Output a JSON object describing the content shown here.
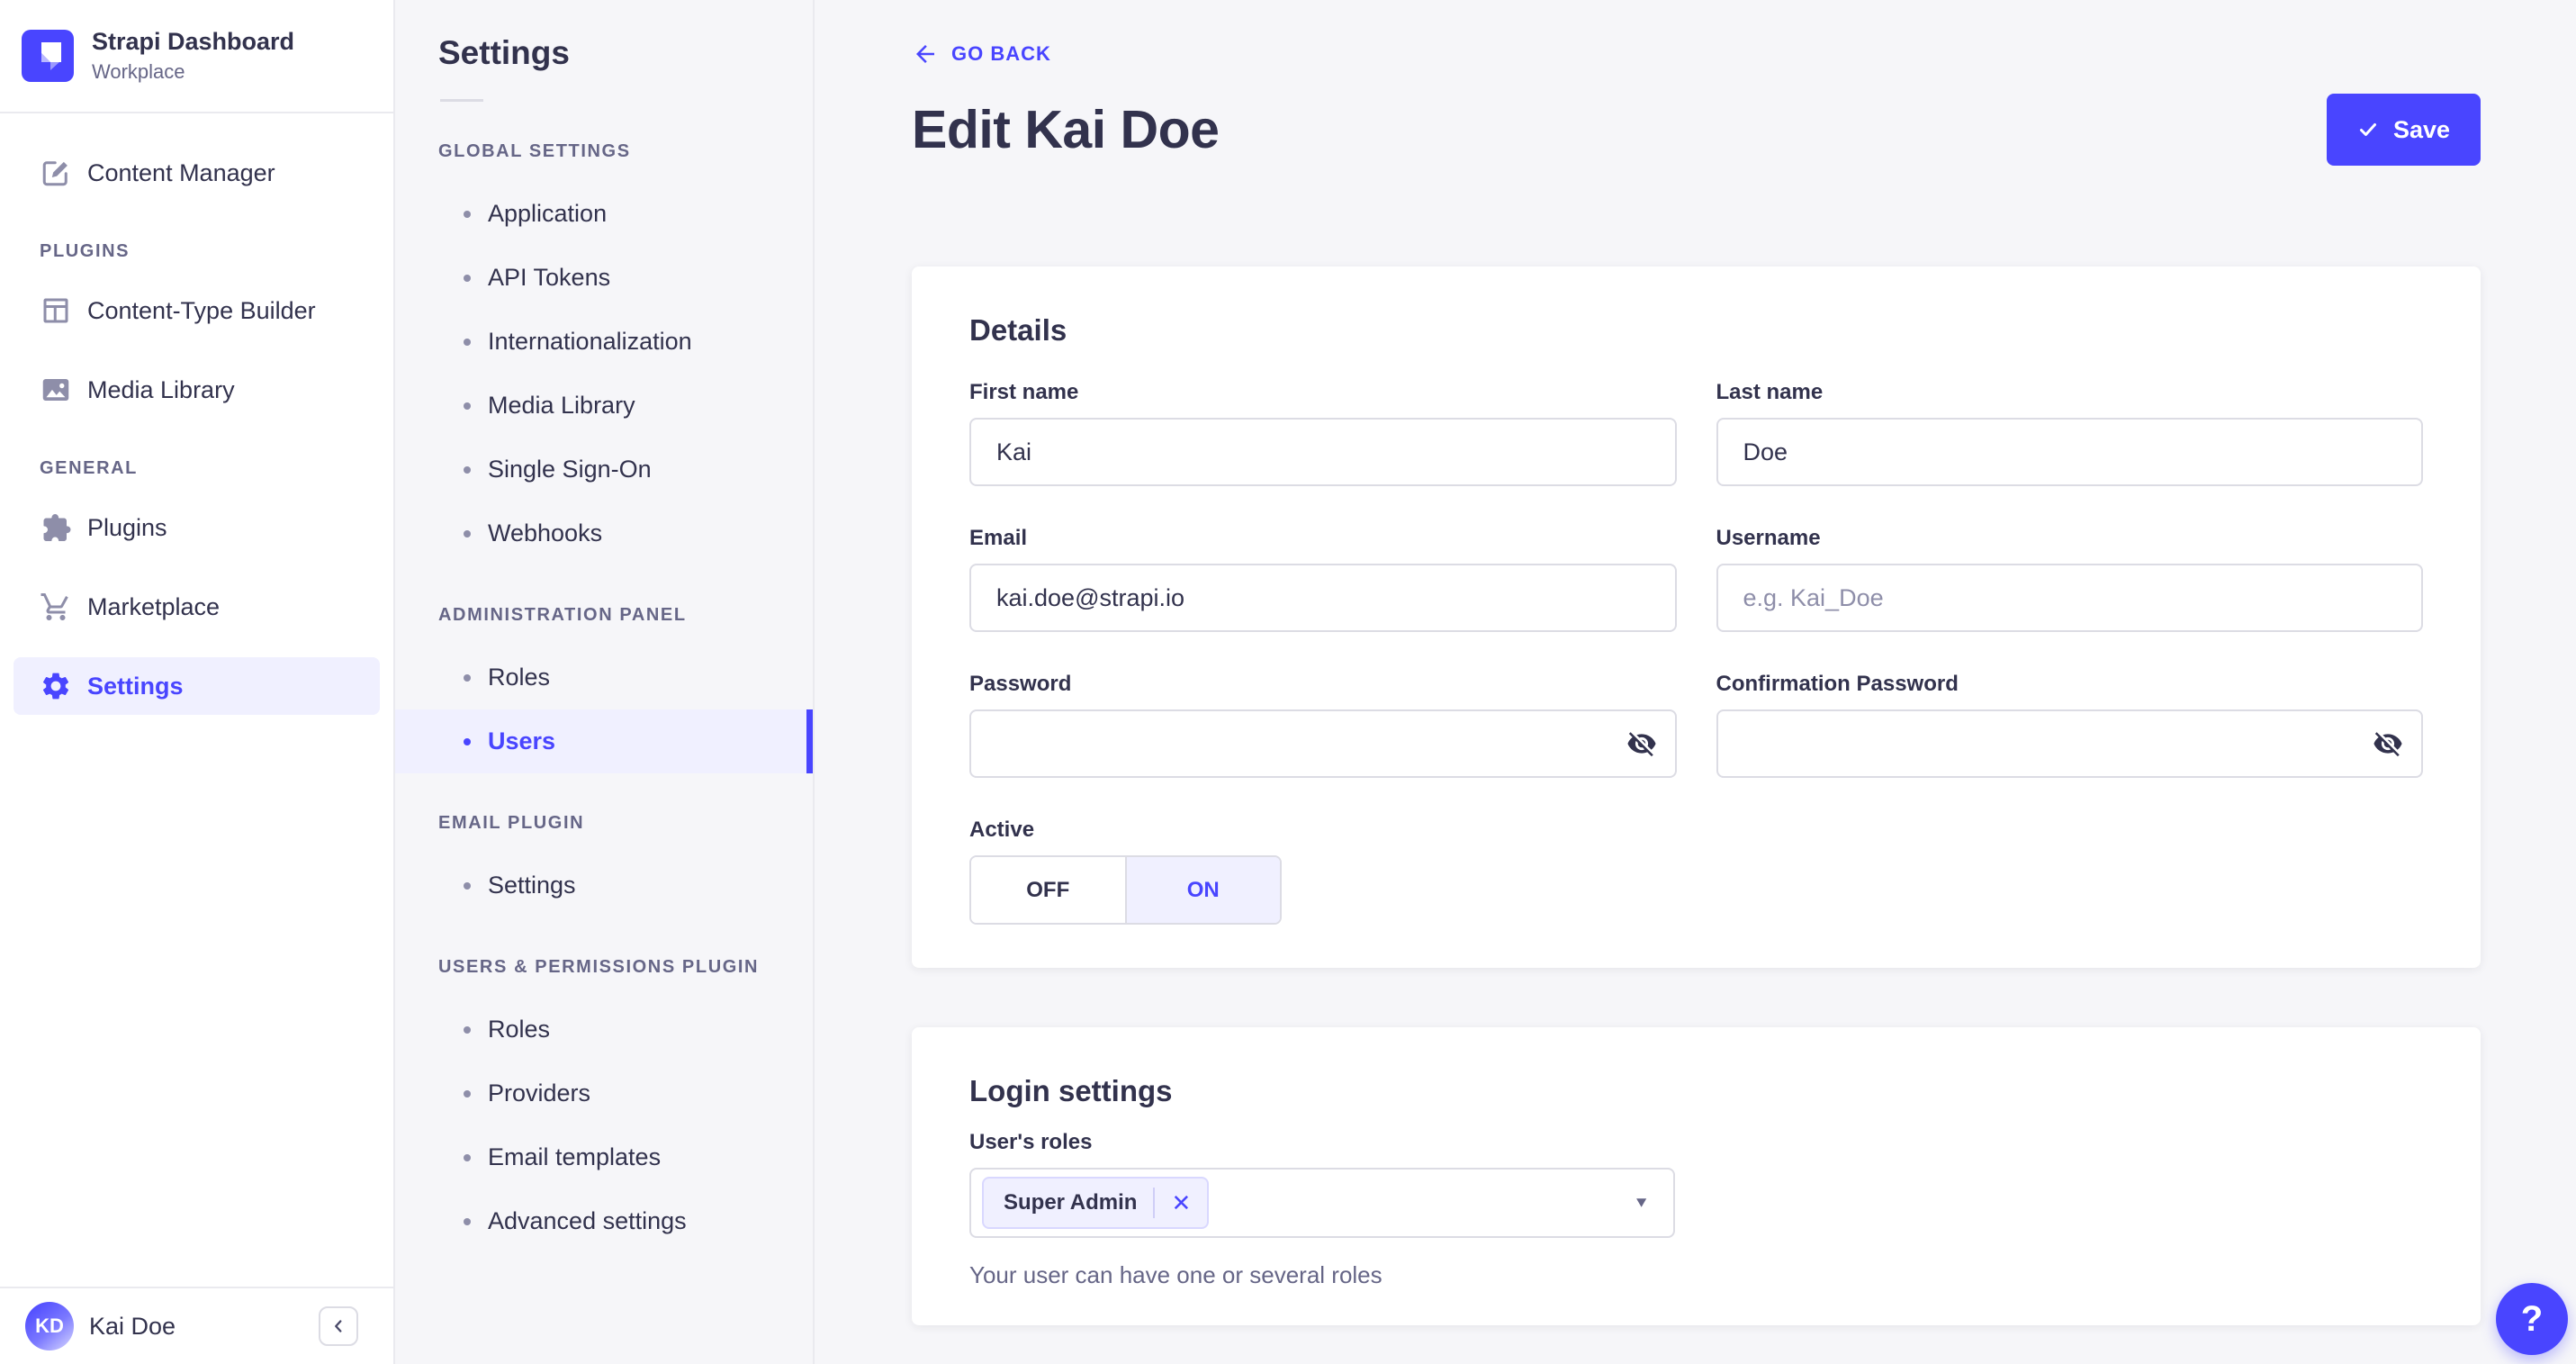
{
  "brand": {
    "title": "Strapi Dashboard",
    "subtitle": "Workplace"
  },
  "sidebar": {
    "content_manager_label": "Content Manager",
    "sections": [
      {
        "label": "PLUGINS",
        "items": [
          {
            "label": "Content-Type Builder"
          },
          {
            "label": "Media Library"
          }
        ]
      },
      {
        "label": "GENERAL",
        "items": [
          {
            "label": "Plugins"
          },
          {
            "label": "Marketplace"
          },
          {
            "label": "Settings",
            "active": true
          }
        ]
      }
    ],
    "user": {
      "initials": "KD",
      "name": "Kai Doe"
    }
  },
  "subnav": {
    "title": "Settings",
    "sections": [
      {
        "label": "GLOBAL SETTINGS",
        "items": [
          {
            "label": "Application"
          },
          {
            "label": "API Tokens"
          },
          {
            "label": "Internationalization"
          },
          {
            "label": "Media Library"
          },
          {
            "label": "Single Sign-On"
          },
          {
            "label": "Webhooks"
          }
        ]
      },
      {
        "label": "ADMINISTRATION PANEL",
        "items": [
          {
            "label": "Roles"
          },
          {
            "label": "Users",
            "active": true
          }
        ]
      },
      {
        "label": "EMAIL PLUGIN",
        "items": [
          {
            "label": "Settings"
          }
        ]
      },
      {
        "label": "USERS & PERMISSIONS PLUGIN",
        "items": [
          {
            "label": "Roles"
          },
          {
            "label": "Providers"
          },
          {
            "label": "Email templates"
          },
          {
            "label": "Advanced settings"
          }
        ]
      }
    ]
  },
  "header": {
    "back_label": "GO BACK",
    "title": "Edit Kai Doe",
    "save_label": "Save"
  },
  "details": {
    "title": "Details",
    "first_name": {
      "label": "First name",
      "value": "Kai"
    },
    "last_name": {
      "label": "Last name",
      "value": "Doe"
    },
    "email": {
      "label": "Email",
      "value": "kai.doe@strapi.io"
    },
    "username": {
      "label": "Username",
      "placeholder": "e.g. Kai_Doe"
    },
    "password": {
      "label": "Password"
    },
    "confirmation_password": {
      "label": "Confirmation Password"
    },
    "active": {
      "label": "Active",
      "off": "OFF",
      "on": "ON",
      "selected": "ON"
    }
  },
  "login": {
    "title": "Login settings",
    "roles_label": "User's roles",
    "role_tag": "Super Admin",
    "helper": "Your user can have one or several roles"
  },
  "help": {
    "label": "?"
  },
  "icons": {
    "close": "✕",
    "caret_down": "▼"
  },
  "colors": {
    "primary": "#4945ff",
    "primary_light": "#f0f0ff",
    "text": "#32324d",
    "muted": "#666687",
    "border": "#dcdce4",
    "background": "#f6f6f9"
  }
}
